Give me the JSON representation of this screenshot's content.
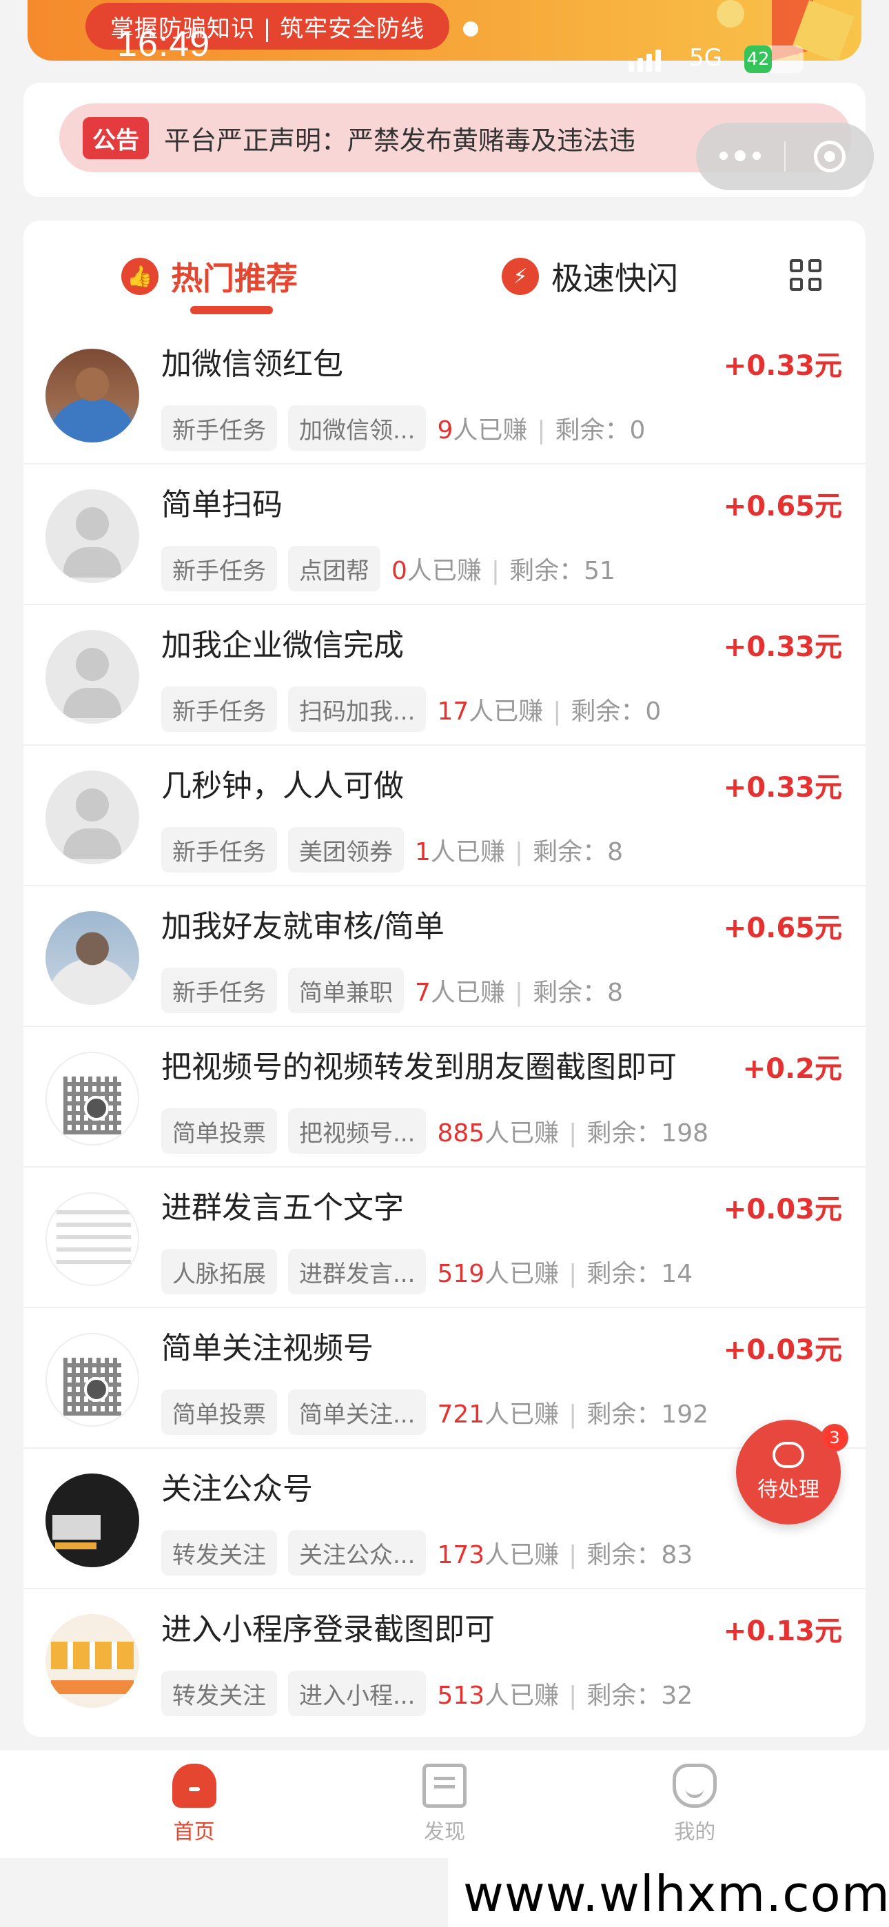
{
  "status_bar": {
    "time": "16:49",
    "network": "5G",
    "battery": "42"
  },
  "banner": {
    "text": "掌握防骗知识 | 筑牢安全防线"
  },
  "notice": {
    "tag": "公告",
    "text": "平台严正声明：严禁发布黄赌毒及违法违"
  },
  "tabs": {
    "hot": "热门推荐",
    "fast": "极速快闪"
  },
  "tasks": [
    {
      "title": "加微信领红包",
      "reward": "+0.33元",
      "tag1": "新手任务",
      "tag2": "加微信领...",
      "earned": "9",
      "earned_suffix": "人已赚",
      "remaining_label": "剩余：",
      "remaining": "0"
    },
    {
      "title": "简单扫码",
      "reward": "+0.65元",
      "tag1": "新手任务",
      "tag2": "点团帮",
      "earned": "0",
      "earned_suffix": "人已赚",
      "remaining_label": "剩余：",
      "remaining": "51"
    },
    {
      "title": "加我企业微信完成",
      "reward": "+0.33元",
      "tag1": "新手任务",
      "tag2": "扫码加我...",
      "earned": "17",
      "earned_suffix": "人已赚",
      "remaining_label": "剩余：",
      "remaining": "0"
    },
    {
      "title": "几秒钟，人人可做",
      "reward": "+0.33元",
      "tag1": "新手任务",
      "tag2": "美团领券",
      "earned": "1",
      "earned_suffix": "人已赚",
      "remaining_label": "剩余：",
      "remaining": "8"
    },
    {
      "title": "加我好友就审核/简单",
      "reward": "+0.65元",
      "tag1": "新手任务",
      "tag2": "简单兼职",
      "earned": "7",
      "earned_suffix": "人已赚",
      "remaining_label": "剩余：",
      "remaining": "8"
    },
    {
      "title": "把视频号的视频转发到朋友圈截图即可",
      "reward": "+0.2元",
      "tag1": "简单投票",
      "tag2": "把视频号...",
      "earned": "885",
      "earned_suffix": "人已赚",
      "remaining_label": "剩余：",
      "remaining": "198"
    },
    {
      "title": "进群发言五个文字",
      "reward": "+0.03元",
      "tag1": "人脉拓展",
      "tag2": "进群发言...",
      "earned": "519",
      "earned_suffix": "人已赚",
      "remaining_label": "剩余：",
      "remaining": "14"
    },
    {
      "title": "简单关注视频号",
      "reward": "+0.03元",
      "tag1": "简单投票",
      "tag2": "简单关注...",
      "earned": "721",
      "earned_suffix": "人已赚",
      "remaining_label": "剩余：",
      "remaining": "192"
    },
    {
      "title": "关注公众号",
      "reward": "",
      "tag1": "转发关注",
      "tag2": "关注公众...",
      "earned": "173",
      "earned_suffix": "人已赚",
      "remaining_label": "剩余：",
      "remaining": "83"
    },
    {
      "title": "进入小程序登录截图即可",
      "reward": "+0.13元",
      "tag1": "转发关注",
      "tag2": "进入小程...",
      "earned": "513",
      "earned_suffix": "人已赚",
      "remaining_label": "剩余：",
      "remaining": "32"
    }
  ],
  "pending": {
    "label": "待处理",
    "count": "3"
  },
  "bottom_nav": {
    "home": "首页",
    "withdraw": "发现",
    "me": "我的"
  },
  "watermark": "www.wlhxm.com",
  "colors": {
    "accent": "#e5462f",
    "reward": "#e5312f",
    "notice_bg": "#f8d6d6"
  }
}
